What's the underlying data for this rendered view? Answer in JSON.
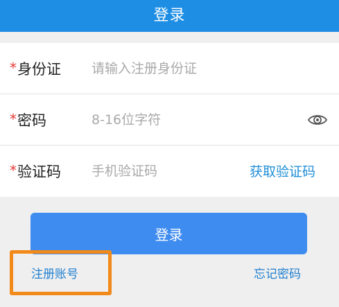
{
  "header": {
    "title": "登录"
  },
  "form": {
    "required_mark": "*",
    "id_card": {
      "label": "身份证",
      "placeholder": "请输入注册身份证"
    },
    "password": {
      "label": "密码",
      "placeholder": "8-16位字符",
      "icon": "eye-icon"
    },
    "verify_code": {
      "label": "验证码",
      "placeholder": "手机验证码",
      "action": "获取验证码"
    }
  },
  "login_button": "登录",
  "links": {
    "register": "注册账号",
    "forgot": "忘记密码"
  },
  "colors": {
    "header": "#1e8ee5",
    "button": "#3f8cf0",
    "link": "#1f7fd0",
    "required": "#e53935",
    "highlight": "#f28a1a"
  }
}
